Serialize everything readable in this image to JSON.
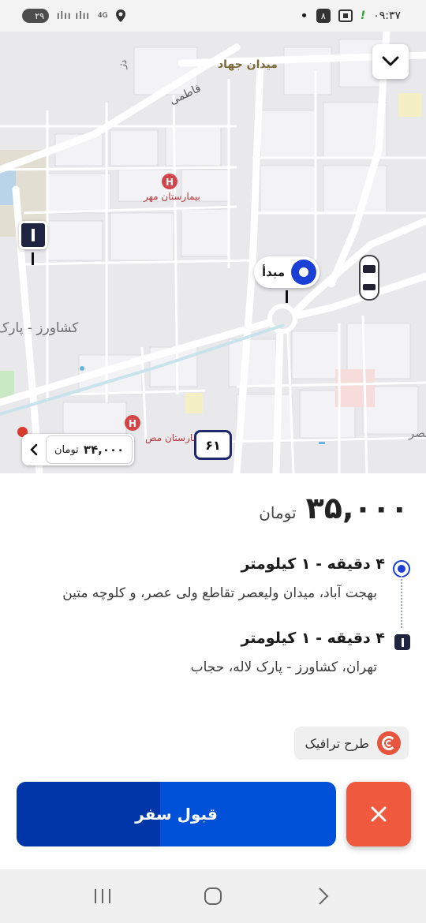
{
  "status_bar": {
    "time": "۰۹:۳۷",
    "battery": "۲۹",
    "network": "4G",
    "notification_count": "۸",
    "icons": [
      "battery-icon",
      "signal-icon",
      "location-icon",
      "dot-icon",
      "notification-badge-icon",
      "scan-icon",
      "alert-icon"
    ]
  },
  "map": {
    "labels": {
      "maydan_jahad": "میدان جهاد",
      "fatemi": "فاطمی",
      "hospital_mehr": "بیمارستان مهر",
      "keshavarz_park": "کشاورز - پارک",
      "hospital_bottom": "بیمارستان مص",
      "street_top": "دژ",
      "right_edge": "عصر"
    },
    "origin_label": "مبدأ",
    "route_badge": "۶۱",
    "price_chip": {
      "amount": "۳۴,۰۰۰",
      "unit": "تومان"
    },
    "colors": {
      "road": "#ffffff",
      "block": "#e9e9ec",
      "park": "#c9e8c4",
      "origin": "#1a3fd6"
    }
  },
  "trip": {
    "price_amount": "۳۵,۰۰۰",
    "price_unit": "تومان",
    "origin": {
      "title": "۴ دقیقه - ۱ کیلومتر",
      "address": "بهجت آباد، میدان ولیعصر تقاطع ولی عصر، و کلوچه متین"
    },
    "destination": {
      "title": "۴ دقیقه - ۱ کیلومتر",
      "address": "تهران، کشاورز - پارک لاله، حجاب"
    },
    "traffic_label": "طرح ترافیک",
    "accept_label": "قبول سفر",
    "accept_progress": 0.45
  },
  "colors": {
    "accept": "#0050d8",
    "accept_progress": "#0036a8",
    "reject": "#ef5a3f",
    "traffic": "#e8553e"
  }
}
